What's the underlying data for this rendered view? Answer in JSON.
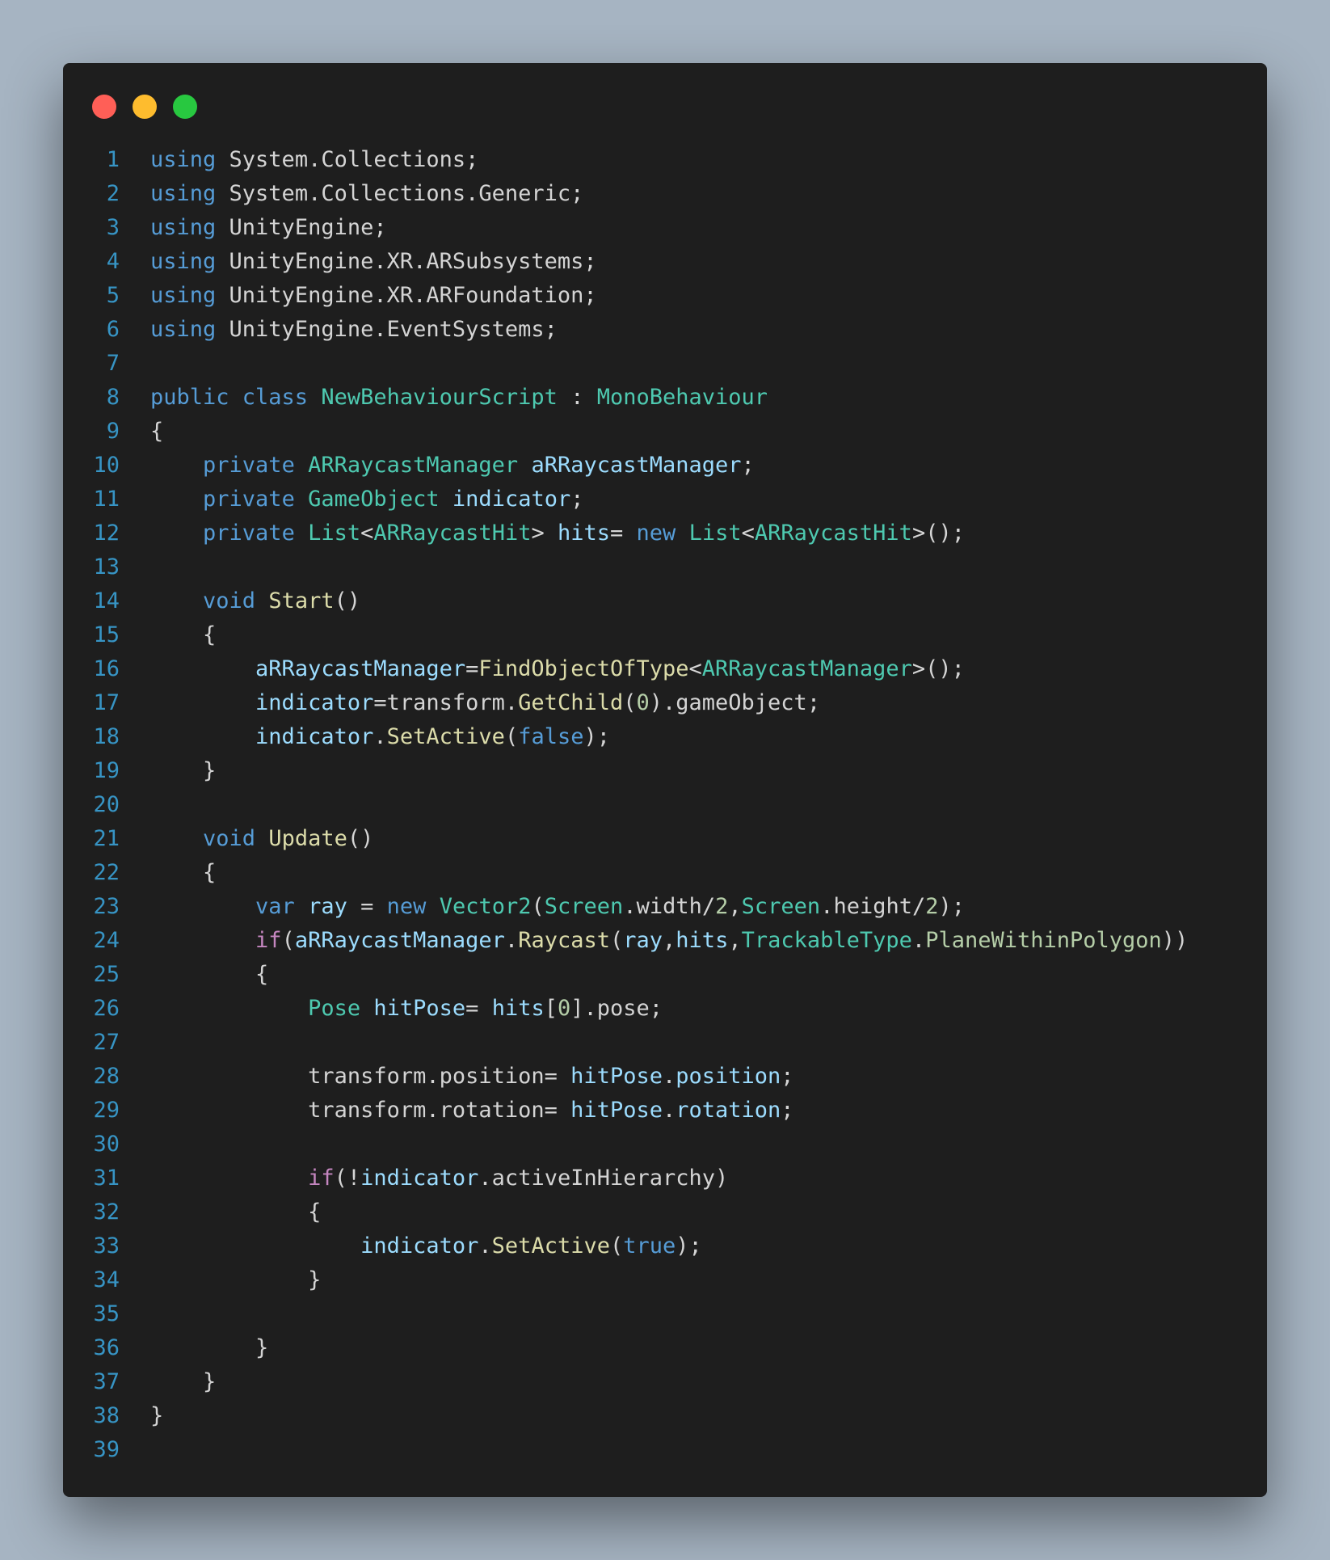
{
  "window": {
    "controls": [
      {
        "name": "close",
        "color": "#ff5f57"
      },
      {
        "name": "minimize",
        "color": "#febc2e"
      },
      {
        "name": "maximize",
        "color": "#28c840"
      }
    ]
  },
  "editor": {
    "language": "csharp",
    "lines": [
      {
        "n": "1",
        "tokens": [
          {
            "t": "using",
            "c": "kw"
          },
          {
            "t": " System.Collections;",
            "c": "plain"
          }
        ]
      },
      {
        "n": "2",
        "tokens": [
          {
            "t": "using",
            "c": "kw"
          },
          {
            "t": " System.Collections.Generic;",
            "c": "plain"
          }
        ]
      },
      {
        "n": "3",
        "tokens": [
          {
            "t": "using",
            "c": "kw"
          },
          {
            "t": " UnityEngine;",
            "c": "plain"
          }
        ]
      },
      {
        "n": "4",
        "tokens": [
          {
            "t": "using",
            "c": "kw"
          },
          {
            "t": " UnityEngine.XR.ARSubsystems;",
            "c": "plain"
          }
        ]
      },
      {
        "n": "5",
        "tokens": [
          {
            "t": "using",
            "c": "kw"
          },
          {
            "t": " UnityEngine.XR.ARFoundation;",
            "c": "plain"
          }
        ]
      },
      {
        "n": "6",
        "tokens": [
          {
            "t": "using",
            "c": "kw"
          },
          {
            "t": " UnityEngine.EventSystems;",
            "c": "plain"
          }
        ]
      },
      {
        "n": "7",
        "tokens": []
      },
      {
        "n": "8",
        "tokens": [
          {
            "t": "public class",
            "c": "kw"
          },
          {
            "t": " ",
            "c": "plain"
          },
          {
            "t": "NewBehaviourScript",
            "c": "type"
          },
          {
            "t": " : ",
            "c": "plain"
          },
          {
            "t": "MonoBehaviour",
            "c": "type"
          }
        ]
      },
      {
        "n": "9",
        "tokens": [
          {
            "t": "{",
            "c": "plain"
          }
        ]
      },
      {
        "n": "10",
        "tokens": [
          {
            "t": "    ",
            "c": "plain"
          },
          {
            "t": "private",
            "c": "kw"
          },
          {
            "t": " ",
            "c": "plain"
          },
          {
            "t": "ARRaycastManager",
            "c": "type"
          },
          {
            "t": " ",
            "c": "plain"
          },
          {
            "t": "aRRaycastManager",
            "c": "var"
          },
          {
            "t": ";",
            "c": "plain"
          }
        ]
      },
      {
        "n": "11",
        "tokens": [
          {
            "t": "    ",
            "c": "plain"
          },
          {
            "t": "private",
            "c": "kw"
          },
          {
            "t": " ",
            "c": "plain"
          },
          {
            "t": "GameObject",
            "c": "type"
          },
          {
            "t": " ",
            "c": "plain"
          },
          {
            "t": "indicator",
            "c": "var"
          },
          {
            "t": ";",
            "c": "plain"
          }
        ]
      },
      {
        "n": "12",
        "tokens": [
          {
            "t": "    ",
            "c": "plain"
          },
          {
            "t": "private",
            "c": "kw"
          },
          {
            "t": " ",
            "c": "plain"
          },
          {
            "t": "List",
            "c": "type"
          },
          {
            "t": "<",
            "c": "plain"
          },
          {
            "t": "ARRaycastHit",
            "c": "type"
          },
          {
            "t": "> ",
            "c": "plain"
          },
          {
            "t": "hits",
            "c": "var"
          },
          {
            "t": "= ",
            "c": "plain"
          },
          {
            "t": "new",
            "c": "kw"
          },
          {
            "t": " ",
            "c": "plain"
          },
          {
            "t": "List",
            "c": "type"
          },
          {
            "t": "<",
            "c": "plain"
          },
          {
            "t": "ARRaycastHit",
            "c": "type"
          },
          {
            "t": ">();",
            "c": "plain"
          }
        ]
      },
      {
        "n": "13",
        "tokens": []
      },
      {
        "n": "14",
        "tokens": [
          {
            "t": "    ",
            "c": "plain"
          },
          {
            "t": "void",
            "c": "kw"
          },
          {
            "t": " ",
            "c": "plain"
          },
          {
            "t": "Start",
            "c": "fn"
          },
          {
            "t": "()",
            "c": "plain"
          }
        ]
      },
      {
        "n": "15",
        "tokens": [
          {
            "t": "    {",
            "c": "plain"
          }
        ]
      },
      {
        "n": "16",
        "tokens": [
          {
            "t": "        ",
            "c": "plain"
          },
          {
            "t": "aRRaycastManager",
            "c": "var"
          },
          {
            "t": "=",
            "c": "plain"
          },
          {
            "t": "FindObjectOfType",
            "c": "fn"
          },
          {
            "t": "<",
            "c": "plain"
          },
          {
            "t": "ARRaycastManager",
            "c": "type"
          },
          {
            "t": ">();",
            "c": "plain"
          }
        ]
      },
      {
        "n": "17",
        "tokens": [
          {
            "t": "        ",
            "c": "plain"
          },
          {
            "t": "indicator",
            "c": "var"
          },
          {
            "t": "=transform.",
            "c": "plain"
          },
          {
            "t": "GetChild",
            "c": "fn"
          },
          {
            "t": "(",
            "c": "plain"
          },
          {
            "t": "0",
            "c": "num"
          },
          {
            "t": ").gameObject;",
            "c": "plain"
          }
        ]
      },
      {
        "n": "18",
        "tokens": [
          {
            "t": "        ",
            "c": "plain"
          },
          {
            "t": "indicator",
            "c": "var"
          },
          {
            "t": ".",
            "c": "plain"
          },
          {
            "t": "SetActive",
            "c": "fn"
          },
          {
            "t": "(",
            "c": "plain"
          },
          {
            "t": "false",
            "c": "kw"
          },
          {
            "t": ");",
            "c": "plain"
          }
        ]
      },
      {
        "n": "19",
        "tokens": [
          {
            "t": "    }",
            "c": "plain"
          }
        ]
      },
      {
        "n": "20",
        "tokens": []
      },
      {
        "n": "21",
        "tokens": [
          {
            "t": "    ",
            "c": "plain"
          },
          {
            "t": "void",
            "c": "kw"
          },
          {
            "t": " ",
            "c": "plain"
          },
          {
            "t": "Update",
            "c": "fn"
          },
          {
            "t": "()",
            "c": "plain"
          }
        ]
      },
      {
        "n": "22",
        "tokens": [
          {
            "t": "    {",
            "c": "plain"
          }
        ]
      },
      {
        "n": "23",
        "tokens": [
          {
            "t": "        ",
            "c": "plain"
          },
          {
            "t": "var",
            "c": "kw"
          },
          {
            "t": " ",
            "c": "plain"
          },
          {
            "t": "ray",
            "c": "var"
          },
          {
            "t": " = ",
            "c": "plain"
          },
          {
            "t": "new",
            "c": "kw"
          },
          {
            "t": " ",
            "c": "plain"
          },
          {
            "t": "Vector2",
            "c": "type"
          },
          {
            "t": "(",
            "c": "plain"
          },
          {
            "t": "Screen",
            "c": "type"
          },
          {
            "t": ".width/",
            "c": "plain"
          },
          {
            "t": "2",
            "c": "num"
          },
          {
            "t": ",",
            "c": "plain"
          },
          {
            "t": "Screen",
            "c": "type"
          },
          {
            "t": ".height/",
            "c": "plain"
          },
          {
            "t": "2",
            "c": "num"
          },
          {
            "t": ");",
            "c": "plain"
          }
        ]
      },
      {
        "n": "24",
        "tokens": [
          {
            "t": "        ",
            "c": "plain"
          },
          {
            "t": "if",
            "c": "ctl"
          },
          {
            "t": "(",
            "c": "plain"
          },
          {
            "t": "aRRaycastManager",
            "c": "var"
          },
          {
            "t": ".",
            "c": "plain"
          },
          {
            "t": "Raycast",
            "c": "fn"
          },
          {
            "t": "(",
            "c": "plain"
          },
          {
            "t": "ray",
            "c": "var"
          },
          {
            "t": ",",
            "c": "plain"
          },
          {
            "t": "hits",
            "c": "var"
          },
          {
            "t": ",",
            "c": "plain"
          },
          {
            "t": "TrackableType",
            "c": "type"
          },
          {
            "t": ".",
            "c": "plain"
          },
          {
            "t": "PlaneWithinPolygon",
            "c": "num"
          },
          {
            "t": "))",
            "c": "plain"
          }
        ]
      },
      {
        "n": "25",
        "tokens": [
          {
            "t": "        {",
            "c": "plain"
          }
        ]
      },
      {
        "n": "26",
        "tokens": [
          {
            "t": "            ",
            "c": "plain"
          },
          {
            "t": "Pose",
            "c": "type"
          },
          {
            "t": " ",
            "c": "plain"
          },
          {
            "t": "hitPose",
            "c": "var"
          },
          {
            "t": "= ",
            "c": "plain"
          },
          {
            "t": "hits",
            "c": "var"
          },
          {
            "t": "[",
            "c": "plain"
          },
          {
            "t": "0",
            "c": "num"
          },
          {
            "t": "].pose;",
            "c": "plain"
          }
        ]
      },
      {
        "n": "27",
        "tokens": []
      },
      {
        "n": "28",
        "tokens": [
          {
            "t": "            transform.position= ",
            "c": "plain"
          },
          {
            "t": "hitPose",
            "c": "var"
          },
          {
            "t": ".",
            "c": "plain"
          },
          {
            "t": "position",
            "c": "var"
          },
          {
            "t": ";",
            "c": "plain"
          }
        ]
      },
      {
        "n": "29",
        "tokens": [
          {
            "t": "            transform.rotation= ",
            "c": "plain"
          },
          {
            "t": "hitPose",
            "c": "var"
          },
          {
            "t": ".",
            "c": "plain"
          },
          {
            "t": "rotation",
            "c": "var"
          },
          {
            "t": ";",
            "c": "plain"
          }
        ]
      },
      {
        "n": "30",
        "tokens": []
      },
      {
        "n": "31",
        "tokens": [
          {
            "t": "            ",
            "c": "plain"
          },
          {
            "t": "if",
            "c": "ctl"
          },
          {
            "t": "(!",
            "c": "plain"
          },
          {
            "t": "indicator",
            "c": "var"
          },
          {
            "t": ".activeInHierarchy)",
            "c": "plain"
          }
        ]
      },
      {
        "n": "32",
        "tokens": [
          {
            "t": "            {",
            "c": "plain"
          }
        ]
      },
      {
        "n": "33",
        "tokens": [
          {
            "t": "                ",
            "c": "plain"
          },
          {
            "t": "indicator",
            "c": "var"
          },
          {
            "t": ".",
            "c": "plain"
          },
          {
            "t": "SetActive",
            "c": "fn"
          },
          {
            "t": "(",
            "c": "plain"
          },
          {
            "t": "true",
            "c": "kw"
          },
          {
            "t": ");",
            "c": "plain"
          }
        ]
      },
      {
        "n": "34",
        "tokens": [
          {
            "t": "            }",
            "c": "plain"
          }
        ]
      },
      {
        "n": "35",
        "tokens": []
      },
      {
        "n": "36",
        "tokens": [
          {
            "t": "        }",
            "c": "plain"
          }
        ]
      },
      {
        "n": "37",
        "tokens": [
          {
            "t": "    }",
            "c": "plain"
          }
        ]
      },
      {
        "n": "38",
        "tokens": [
          {
            "t": "}",
            "c": "plain"
          }
        ]
      },
      {
        "n": "39",
        "tokens": []
      }
    ]
  }
}
